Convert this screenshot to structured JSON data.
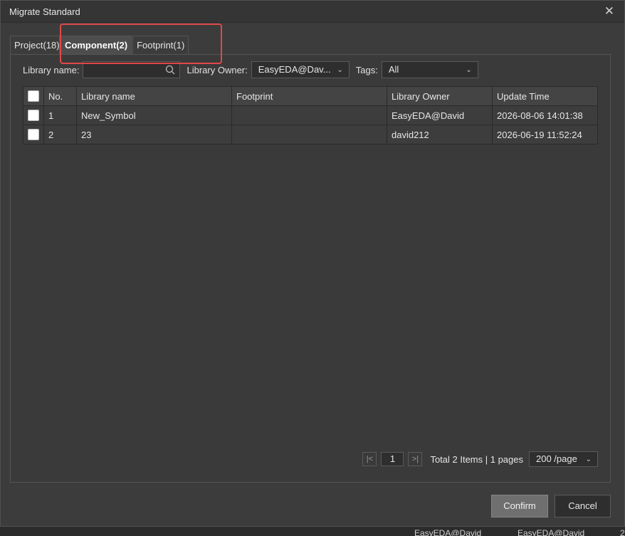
{
  "dialog": {
    "title": "Migrate Standard",
    "close_glyph": "✕"
  },
  "tabs": [
    {
      "label": "Project(18)"
    },
    {
      "label": "Component(2)"
    },
    {
      "label": "Footprint(1)"
    }
  ],
  "filters": {
    "library_name_label": "Library name:",
    "library_name_value": "",
    "library_owner_label": "Library Owner:",
    "library_owner_value": "EasyEDA@Dav...",
    "tags_label": "Tags:",
    "tags_value": "All"
  },
  "table": {
    "headers": [
      "No.",
      "Library name",
      "Footprint",
      "Library Owner",
      "Update Time"
    ],
    "rows": [
      {
        "no": "1",
        "library_name": "New_Symbol",
        "footprint": "",
        "owner": "EasyEDA@David",
        "updated": "2026-08-06 14:01:38"
      },
      {
        "no": "2",
        "library_name": "23",
        "footprint": "",
        "owner": "david212",
        "updated": "2026-06-19 11:52:24"
      }
    ]
  },
  "pagination": {
    "first_glyph": "|<",
    "page": "1",
    "last_glyph": ">|",
    "total_text": "Total 2 Items | 1 pages",
    "page_size": "200 /page"
  },
  "buttons": {
    "confirm": "Confirm",
    "cancel": "Cancel"
  },
  "background_strip": [
    "EasyEDA@David",
    "EasyEDA@David",
    "2"
  ],
  "colors": {
    "highlight_box": "#e04848",
    "dialog_bg": "#3c3c3c"
  }
}
